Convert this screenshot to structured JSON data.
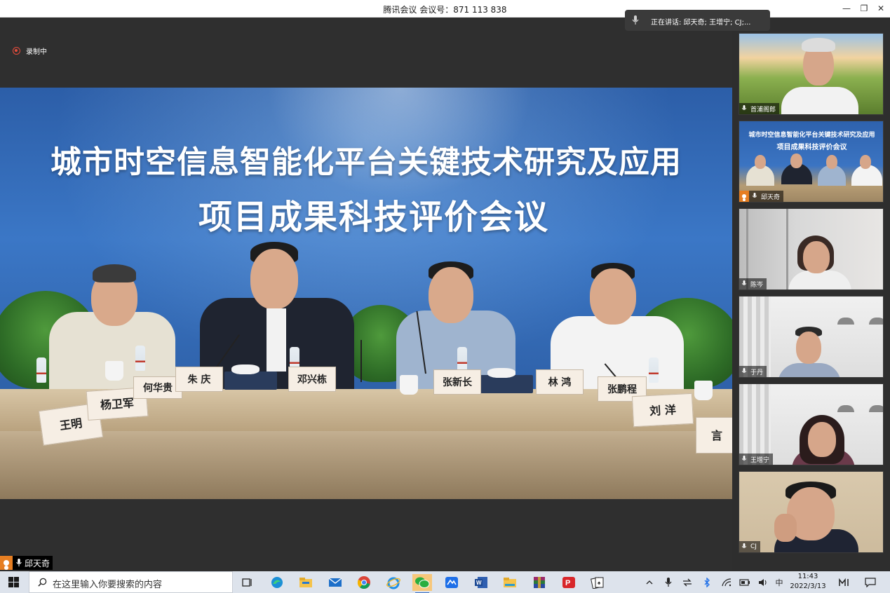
{
  "window": {
    "title": "腾讯会议 会议号：871 113 838",
    "min_label": "—",
    "max_label": "❐",
    "close_label": "✕"
  },
  "speaking": {
    "text": "正在讲话: 邱天奇; 王增宁; CJ;..."
  },
  "recording": {
    "label": "录制中"
  },
  "main_video": {
    "banner_line1": "城市时空信息智能化平台关键技术研究及应用",
    "banner_line2": "项目成果科技评价会议",
    "nameplates": [
      "王明",
      "杨卫军",
      "何华贵",
      "朱 庆",
      "邓兴栋",
      "张新长",
      "林 鸿",
      "张鹏程",
      "刘 洋",
      "言"
    ],
    "speaker_name": "邱天奇",
    "menu_icon": "list-icon"
  },
  "participants": [
    {
      "name": "首浦阁郎",
      "label_icon": "mic-icon"
    },
    {
      "name": "邱天奇",
      "label_icon": "mic-icon",
      "host": true,
      "slide_line1": "城市时空信息智能化平台关键技术研究及应用",
      "slide_line2": "项目成果科技评价会议"
    },
    {
      "name": "陈岑",
      "label_icon": "mic-icon"
    },
    {
      "name": "于丹",
      "label_icon": "mic-icon"
    },
    {
      "name": "王增宁",
      "label_icon": "mic-icon"
    },
    {
      "name": "CJ",
      "label_icon": "mic-icon"
    }
  ],
  "taskbar": {
    "search_placeholder": "在这里输入你要搜索的内容",
    "apps": [
      "task-view-icon",
      "edge-icon",
      "file-explorer-icon",
      "mail-icon",
      "chrome-icon",
      "ie-icon",
      "wechat-icon",
      "tencent-meeting-icon",
      "word-icon",
      "folder-icon",
      "winrar-icon",
      "wps-icon",
      "cards-icon"
    ],
    "ime": "中",
    "time": "11:43",
    "date": "2022/3/13"
  },
  "colors": {
    "accent": "#e67e22",
    "record": "#e74c3c",
    "taskbar_bg": "#dde3ec"
  }
}
